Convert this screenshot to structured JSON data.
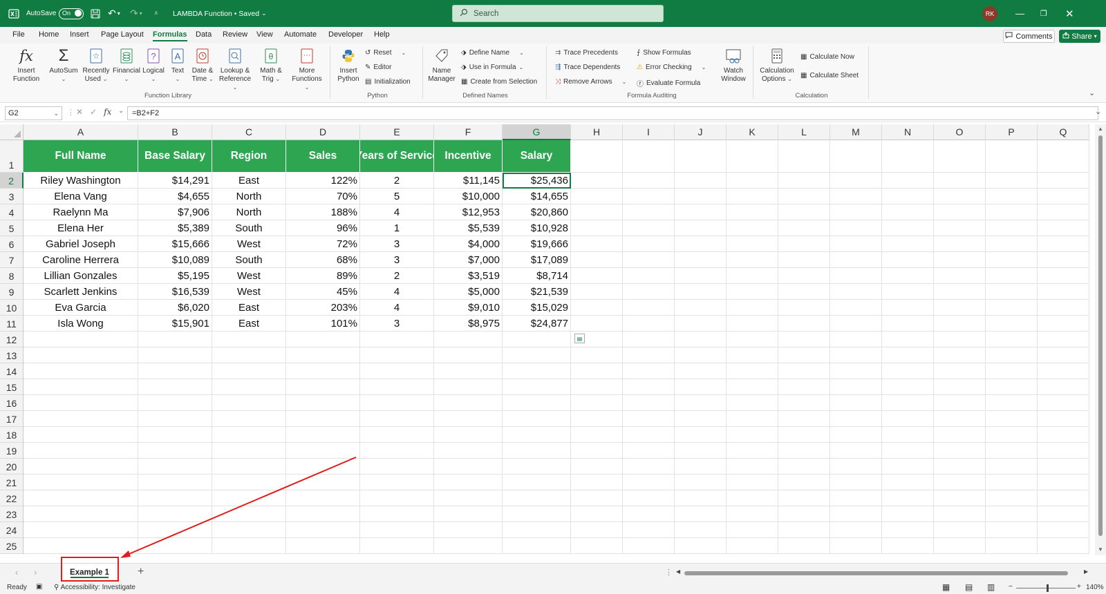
{
  "titlebar": {
    "autosave_label": "AutoSave",
    "autosave_state": "On",
    "doc_title": "LAMBDA Function • Saved",
    "search_placeholder": "Search",
    "user_initials": "RK"
  },
  "menu": {
    "tabs": [
      "File",
      "Home",
      "Insert",
      "Page Layout",
      "Formulas",
      "Data",
      "Review",
      "View",
      "Automate",
      "Developer",
      "Help"
    ],
    "active_tab": "Formulas",
    "comments_label": "Comments",
    "share_label": "Share"
  },
  "ribbon": {
    "function_library": {
      "label": "Function Library",
      "insert_function": [
        "Insert",
        "Function"
      ],
      "autosum": "AutoSum",
      "recently_used": [
        "Recently",
        "Used"
      ],
      "financial": "Financial",
      "logical": "Logical",
      "text": "Text",
      "date_time": [
        "Date &",
        "Time"
      ],
      "lookup_reference": [
        "Lookup &",
        "Reference"
      ],
      "math_trig": [
        "Math &",
        "Trig"
      ],
      "more_functions": [
        "More",
        "Functions"
      ]
    },
    "python": {
      "label": "Python",
      "insert_python": [
        "Insert",
        "Python"
      ],
      "reset": "Reset",
      "editor": "Editor",
      "initialization": "Initialization"
    },
    "defined_names": {
      "label": "Defined Names",
      "name_manager": [
        "Name",
        "Manager"
      ],
      "define_name": "Define Name",
      "use_in_formula": "Use in Formula",
      "create_from_selection": "Create from Selection"
    },
    "formula_auditing": {
      "label": "Formula Auditing",
      "trace_precedents": "Trace Precedents",
      "trace_dependents": "Trace Dependents",
      "remove_arrows": "Remove Arrows",
      "show_formulas": "Show Formulas",
      "error_checking": "Error Checking",
      "evaluate_formula": "Evaluate Formula",
      "watch_window": [
        "Watch",
        "Window"
      ]
    },
    "calculation": {
      "label": "Calculation",
      "calculation_options": [
        "Calculation",
        "Options"
      ],
      "calculate_now": "Calculate Now",
      "calculate_sheet": "Calculate Sheet"
    }
  },
  "formula_bar": {
    "name_box": "G2",
    "formula": "=B2+F2"
  },
  "grid": {
    "columns": [
      "A",
      "B",
      "C",
      "D",
      "E",
      "F",
      "G",
      "H",
      "I",
      "J",
      "K",
      "L",
      "M",
      "N",
      "O",
      "P",
      "Q"
    ],
    "rows": [
      "1",
      "2",
      "3",
      "4",
      "5",
      "6",
      "7",
      "8",
      "9",
      "10",
      "11",
      "12",
      "13",
      "14",
      "15",
      "16",
      "17",
      "18",
      "19",
      "20",
      "21",
      "22",
      "23",
      "24",
      "25"
    ],
    "headers": [
      "Full Name",
      "Base Salary",
      "Region",
      "Sales",
      "Years of Service",
      "Incentive",
      "Salary"
    ],
    "data": [
      [
        "Riley Washington",
        "$14,291",
        "East",
        "122%",
        "2",
        "$11,145",
        "$25,436"
      ],
      [
        "Elena Vang",
        "$4,655",
        "North",
        "70%",
        "5",
        "$10,000",
        "$14,655"
      ],
      [
        "Raelynn Ma",
        "$7,906",
        "North",
        "188%",
        "4",
        "$12,953",
        "$20,860"
      ],
      [
        "Elena Her",
        "$5,389",
        "South",
        "96%",
        "1",
        "$5,539",
        "$10,928"
      ],
      [
        "Gabriel Joseph",
        "$15,666",
        "West",
        "72%",
        "3",
        "$4,000",
        "$19,666"
      ],
      [
        "Caroline Herrera",
        "$10,089",
        "South",
        "68%",
        "3",
        "$7,000",
        "$17,089"
      ],
      [
        "Lillian Gonzales",
        "$5,195",
        "West",
        "89%",
        "2",
        "$3,519",
        "$8,714"
      ],
      [
        "Scarlett Jenkins",
        "$16,539",
        "West",
        "45%",
        "4",
        "$5,000",
        "$21,539"
      ],
      [
        "Eva Garcia",
        "$6,020",
        "East",
        "203%",
        "4",
        "$9,010",
        "$15,029"
      ],
      [
        "Isla Wong",
        "$15,901",
        "East",
        "101%",
        "3",
        "$8,975",
        "$24,877"
      ]
    ]
  },
  "sheets": {
    "active": "Example 1"
  },
  "status": {
    "ready": "Ready",
    "accessibility": "Accessibility: Investigate",
    "zoom": "140%"
  },
  "colors": {
    "accent": "#107c41",
    "header_fill": "#2ea551",
    "annotation": "#e41b1b"
  }
}
